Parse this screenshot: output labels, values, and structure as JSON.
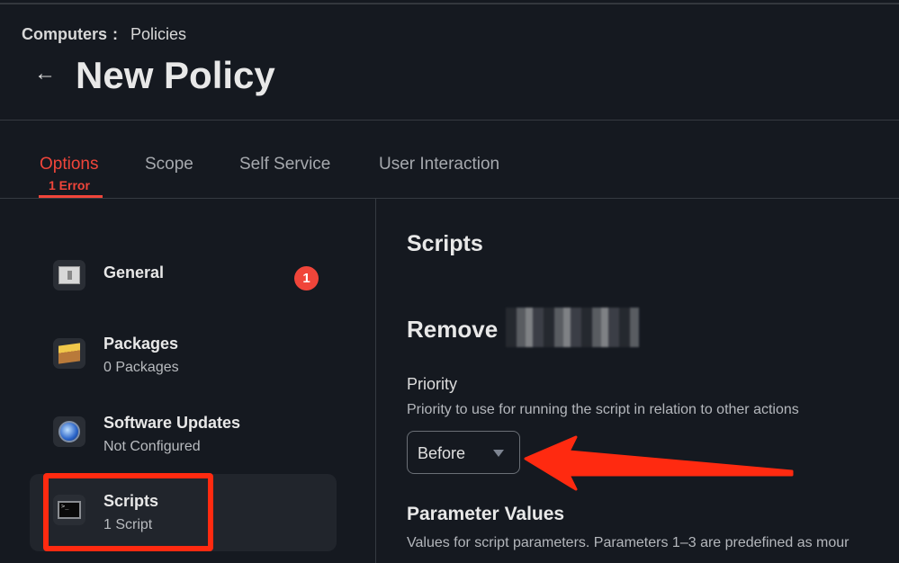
{
  "breadcrumb": {
    "parent": "Computers",
    "separator": ":",
    "current": "Policies"
  },
  "header": {
    "title": "New Policy",
    "back_icon": "arrow-left-icon"
  },
  "tabs": [
    {
      "label": "Options",
      "active": true,
      "error": "1 Error"
    },
    {
      "label": "Scope"
    },
    {
      "label": "Self Service"
    },
    {
      "label": "User Interaction"
    }
  ],
  "sidebar": {
    "items": [
      {
        "label": "General",
        "sub": "",
        "icon": "switch-icon",
        "badge": "1"
      },
      {
        "label": "Packages",
        "sub": "0 Packages",
        "icon": "package-box-icon"
      },
      {
        "label": "Software Updates",
        "sub": "Not Configured",
        "icon": "software-update-globe-icon"
      },
      {
        "label": "Scripts",
        "sub": "1 Script",
        "icon": "terminal-icon",
        "selected": true
      }
    ]
  },
  "main": {
    "section_title": "Scripts",
    "script_name": "Remove",
    "priority": {
      "label": "Priority",
      "description": "Priority to use for running the script in relation to other actions",
      "value": "Before"
    },
    "parameters": {
      "title": "Parameter Values",
      "description": "Values for script parameters. Parameters 1–3 are predefined as mour"
    }
  },
  "colors": {
    "accent": "#f0453a",
    "background": "#151920",
    "annotation": "#ff2a10"
  }
}
